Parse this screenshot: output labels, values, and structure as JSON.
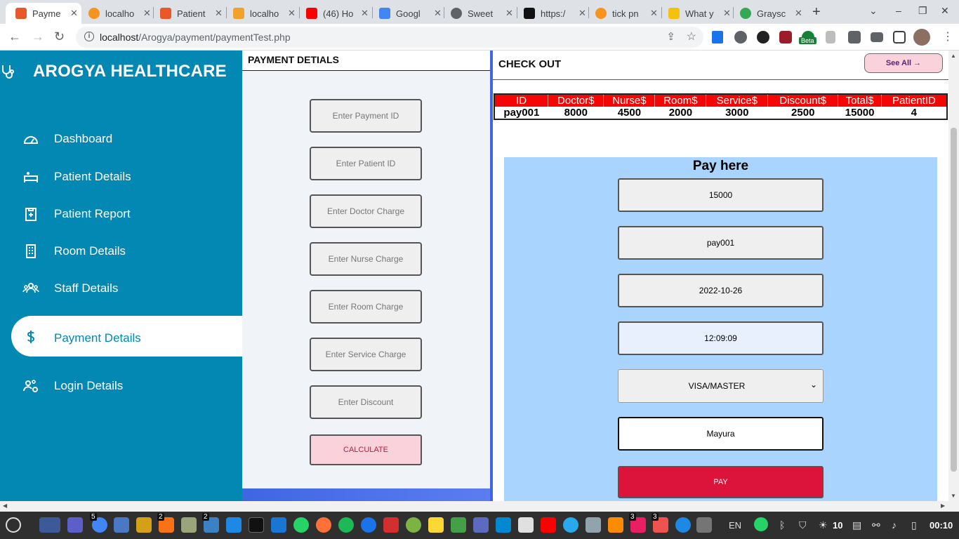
{
  "browser": {
    "tabs": [
      {
        "title": "Payme",
        "active": true,
        "color": "#e8582a"
      },
      {
        "title": "localho",
        "active": false,
        "color": "#f7931e"
      },
      {
        "title": "Patient",
        "active": false,
        "color": "#e8582a"
      },
      {
        "title": "localho",
        "active": false,
        "color": "#f1a22b"
      },
      {
        "title": "(46) Ho",
        "active": false,
        "color": "#ff0000"
      },
      {
        "title": "Googl",
        "active": false,
        "color": "#4285f4"
      },
      {
        "title": "Sweet",
        "active": false,
        "color": "#5f6368"
      },
      {
        "title": "https:/",
        "active": false,
        "color": "#111111"
      },
      {
        "title": "tick pn",
        "active": false,
        "color": "#f7931e"
      },
      {
        "title": "What y",
        "active": false,
        "color": "#f4c20d"
      },
      {
        "title": "Graysc",
        "active": false,
        "color": "#34a853"
      }
    ],
    "url_host": "localhost",
    "url_path": "/Arogya/payment/paymentTest.php",
    "ext_badge": "Beta"
  },
  "sidebar": {
    "brand": "AROGYA HEALTHCARE",
    "items": [
      {
        "label": "Dashboard",
        "icon": "dashboard-icon"
      },
      {
        "label": "Patient Details",
        "icon": "patient-bed-icon"
      },
      {
        "label": "Patient Report",
        "icon": "clipboard-icon"
      },
      {
        "label": "Room Details",
        "icon": "building-icon"
      },
      {
        "label": "Staff Details",
        "icon": "staff-group-icon"
      },
      {
        "label": "Payment Details",
        "icon": "dollar-icon",
        "active": true
      },
      {
        "label": "Login Details",
        "icon": "users-gear-icon"
      }
    ]
  },
  "payment_panel": {
    "title": "PAYMENT DETIALS",
    "fields": {
      "payment_id": "Enter Payment ID",
      "patient_id": "Enter Patient ID",
      "doctor_charge": "Enter Doctor Charge",
      "nurse_charge": "Enter Nurse Charge",
      "room_charge": "Enter Room Charge",
      "service_charge": "Enter Service Charge",
      "discount": "Enter Discount"
    },
    "calculate_label": "CALCULATE"
  },
  "checkout": {
    "title": "CHECK OUT",
    "see_all_label": "See All →",
    "table": {
      "headers": [
        "ID",
        "Doctor$",
        "Nurse$",
        "Room$",
        "Service$",
        "Discount$",
        "Total$",
        "PatientID"
      ],
      "row": [
        "pay001",
        "8000",
        "4500",
        "2000",
        "3000",
        "2500",
        "15000",
        "4"
      ]
    },
    "pay_here": {
      "title": "Pay here",
      "amount": "15000",
      "payment_id": "pay001",
      "date": "2022-10-26",
      "time": "12:09:09",
      "card_type": "VISA/MASTER",
      "name": "Mayura",
      "pay_label": "PAY"
    }
  },
  "taskbar": {
    "lang": "EN",
    "volume": "10",
    "clock": "00:10",
    "badges": [
      "5",
      "2",
      "2",
      "3",
      "3"
    ]
  }
}
